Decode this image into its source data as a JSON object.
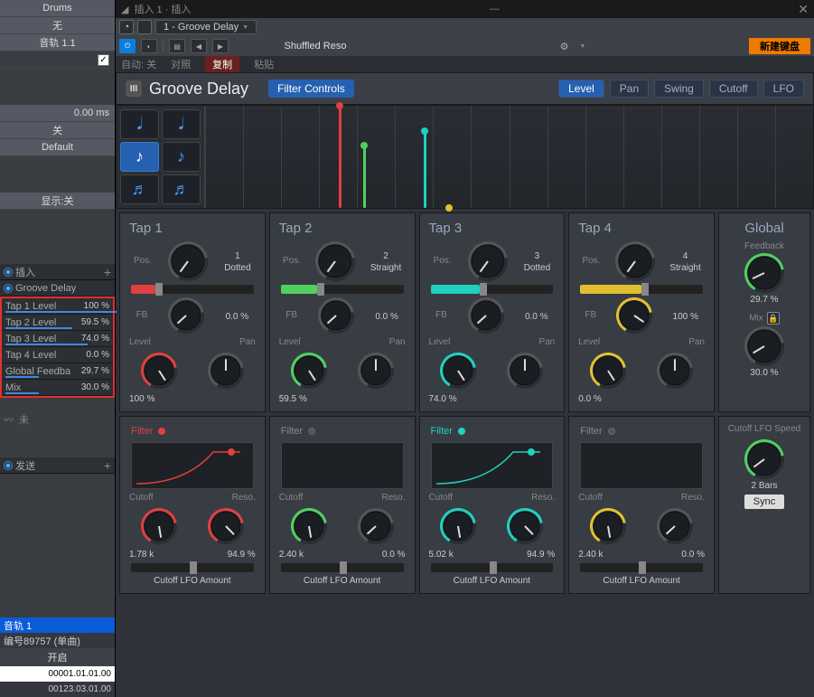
{
  "left": {
    "track_name": "Drums",
    "row2": "无",
    "row3": "音轨 1.1",
    "delay": "0.00 ms",
    "row5": "关",
    "row6": "Default",
    "show_toggle": "显示:关",
    "inserts_hdr": "插入",
    "plugin_name": "Groove Delay",
    "params": [
      {
        "label": "Tap 1 Level",
        "val": "100 %",
        "bar": 100
      },
      {
        "label": "Tap 2 Level",
        "val": "59.5 %",
        "bar": 60
      },
      {
        "label": "Tap 3 Level",
        "val": "74.0 %",
        "bar": 74
      },
      {
        "label": "Tap 4 Level",
        "val": "0.0 %",
        "bar": 0
      },
      {
        "label": "Global Feedba",
        "val": "29.7 %",
        "bar": 30
      },
      {
        "label": "Mix",
        "val": "30.0 %",
        "bar": 30
      }
    ],
    "sends_hdr": "发送",
    "track_sel": "音轨 1",
    "song": "编号89757 (单曲)",
    "open": "开启",
    "time1": "00001.01.01.00",
    "time2": "00123.03.01.00"
  },
  "top": {
    "window_title": "插入 1 · 插入",
    "device_sel": "1 - Groove Delay",
    "preset": "Shuffled Reso",
    "sub": {
      "auto": "自动: 关",
      "compare": "对照",
      "copy": "复制",
      "paste": "粘贴"
    },
    "newkb": "新建键盘"
  },
  "plugin": {
    "title": "Groove Delay",
    "filter_controls": "Filter Controls",
    "modes": [
      "Level",
      "Pan",
      "Swing",
      "Cutoff",
      "LFO"
    ],
    "mode_active": 0
  },
  "taps": [
    {
      "title": "Tap 1",
      "color": "#e04040",
      "pos": "1",
      "posMode": "Dotted",
      "fb": "0.0 %",
      "level": "100 %",
      "pan": "<C>",
      "filterOn": true,
      "cutoff": "1.78 k",
      "reso": "94.9 %",
      "lfoAmt": "Cutoff LFO Amount"
    },
    {
      "title": "Tap 2",
      "color": "#50d060",
      "pos": "2",
      "posMode": "Straight",
      "fb": "0.0 %",
      "level": "59.5 %",
      "pan": "<C>",
      "filterOn": false,
      "cutoff": "2.40 k",
      "reso": "0.0 %",
      "lfoAmt": "Cutoff LFO Amount"
    },
    {
      "title": "Tap 3",
      "color": "#20d0c0",
      "pos": "3",
      "posMode": "Dotted",
      "fb": "0.0 %",
      "level": "74.0 %",
      "pan": "<C>",
      "filterOn": true,
      "cutoff": "5.02 k",
      "reso": "94.9 %",
      "lfoAmt": "Cutoff LFO Amount"
    },
    {
      "title": "Tap 4",
      "color": "#e0c030",
      "pos": "4",
      "posMode": "Straight",
      "fb": "100 %",
      "level": "0.0 %",
      "pan": "<C>",
      "filterOn": false,
      "cutoff": "2.40 k",
      "reso": "0.0 %",
      "lfoAmt": "Cutoff LFO Amount"
    }
  ],
  "global": {
    "title": "Global",
    "feedback_lbl": "Feedback",
    "feedback": "29.7 %",
    "mix_lbl": "Mix",
    "mix": "30.0 %",
    "lfo_lbl": "Cutoff LFO Speed",
    "lfo": "2 Bars",
    "sync": "Sync"
  },
  "labels": {
    "pos": "Pos.",
    "fb": "FB",
    "level": "Level",
    "pan": "Pan",
    "cutoff": "Cutoff",
    "reso": "Reso.",
    "filter": "Filter"
  }
}
